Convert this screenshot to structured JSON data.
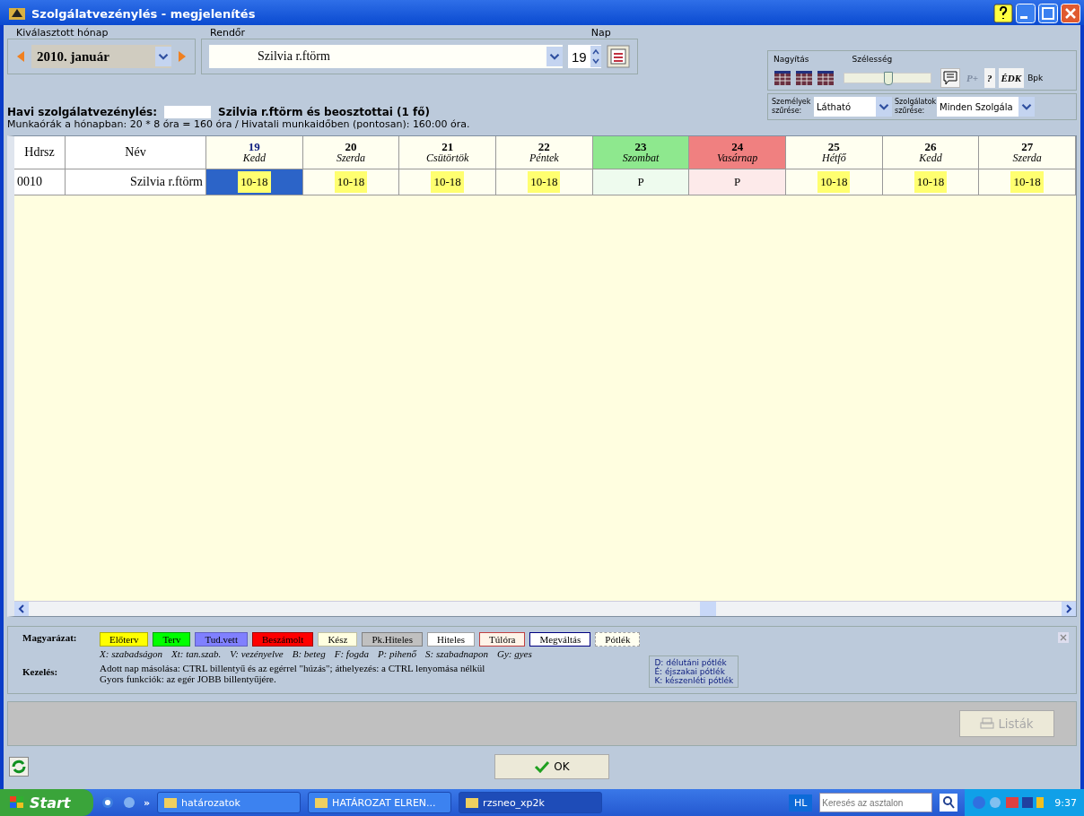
{
  "window": {
    "title": "Szolgálatvezénylés - megjelenítés"
  },
  "month": {
    "label": "Kiválasztott hónap",
    "value": "2010. január"
  },
  "officer": {
    "label": "Rendőr",
    "value": "Szilvia r.ftörm"
  },
  "day": {
    "label": "Nap",
    "value": "19"
  },
  "view": {
    "zoom_label": "Nagyítás",
    "width_label": "Szélesség",
    "width_slider": {
      "level": 0.5
    },
    "buttons": [
      {
        "label": "P+",
        "disabled": true
      },
      {
        "label": "?",
        "disabled": false
      },
      {
        "label": "ÉDK",
        "disabled": false
      }
    ],
    "region": "Bpk"
  },
  "filters": [
    {
      "label": "Személyek szűrése:",
      "value": "Látható"
    },
    {
      "label": "Szolgálatok szűrése:",
      "value": "Minden Szolgála"
    }
  ],
  "summary": {
    "title": "Havi szolgálatvezénylés:",
    "subject": "Szilvia r.ftörm és beosztottai (1 fő)",
    "hours": "Munkaórák a hónapban: 20 * 8 óra = 160 óra / Hivatali munkaidőben (pontosan): 160:00 óra."
  },
  "table": {
    "columns": [
      "Hdrsz",
      "Név"
    ],
    "days": [
      {
        "number": "19",
        "name": "Kedd",
        "kind": "weekday",
        "selected": true
      },
      {
        "number": "20",
        "name": "Szerda",
        "kind": "weekday",
        "selected": false
      },
      {
        "number": "21",
        "name": "Csütörtök",
        "kind": "weekday",
        "selected": false
      },
      {
        "number": "22",
        "name": "Péntek",
        "kind": "weekday",
        "selected": false
      },
      {
        "number": "23",
        "name": "Szombat",
        "kind": "saturday",
        "selected": false
      },
      {
        "number": "24",
        "name": "Vasárnap",
        "kind": "sunday",
        "selected": false
      },
      {
        "number": "25",
        "name": "Hétfő",
        "kind": "weekday",
        "selected": false
      },
      {
        "number": "26",
        "name": "Kedd",
        "kind": "weekday",
        "selected": false
      },
      {
        "number": "27",
        "name": "Szerda",
        "kind": "weekday",
        "selected": false
      }
    ],
    "rows": [
      {
        "id": "0010",
        "name": "Szilvia r.ftörm",
        "cells": [
          {
            "value": "10-18",
            "kind": "shift",
            "selected": true
          },
          {
            "value": "10-18",
            "kind": "shift",
            "selected": false
          },
          {
            "value": "10-18",
            "kind": "shift",
            "selected": false
          },
          {
            "value": "10-18",
            "kind": "shift",
            "selected": false
          },
          {
            "value": "P",
            "kind": "rest",
            "selected": false
          },
          {
            "value": "P",
            "kind": "rest",
            "selected": false
          },
          {
            "value": "10-18",
            "kind": "shift",
            "selected": false
          },
          {
            "value": "10-18",
            "kind": "shift",
            "selected": false
          },
          {
            "value": "10-18",
            "kind": "shift",
            "selected": false
          }
        ]
      }
    ]
  },
  "legend": {
    "label": "Magyarázat:",
    "items": [
      {
        "label": "Előterv",
        "color": "#ffff00"
      },
      {
        "label": "Terv",
        "color": "#00ff00"
      },
      {
        "label": "Tud.vett",
        "color": "#8080ff"
      },
      {
        "label": "Beszámolt",
        "color": "#ff0000"
      },
      {
        "label": "Kész",
        "color": "#ffffe0"
      },
      {
        "label": "Pk.Hiteles",
        "color": "#c0c0c0"
      },
      {
        "label": "Hiteles",
        "color": "#ffffff"
      },
      {
        "label": "Túlóra",
        "color": "#fff4e8"
      },
      {
        "label": "Megváltás",
        "color": "#ffffff"
      },
      {
        "label": "Pótlék",
        "color": "#fffff0"
      }
    ],
    "codes": [
      "X: szabadságon",
      "Xt: tan.szab.",
      "V: vezényelve",
      "B: beteg",
      "F: fogda",
      "P: pihenő",
      "S: szabadnapon",
      "Gy: gyes"
    ],
    "allowances": [
      "D: délutáni pótlék",
      "É: éjszakai pótlék",
      "K: készenléti pótlék"
    ]
  },
  "handling": {
    "label": "Kezelés:",
    "lines": [
      "Adott nap másolása: CTRL billentyű és az egérrel \"húzás\"; áthelyezés: a CTRL lenyomása nélkül",
      "Gyors funkciók: az egér JOBB billentyűjére."
    ]
  },
  "lists_button": {
    "label": "Listák",
    "disabled": true
  },
  "ok_button": {
    "label": "OK"
  },
  "taskbar": {
    "start": "Start",
    "chevron": "»",
    "tasks": [
      {
        "label": "határozatok",
        "selected": false
      },
      {
        "label": "HATÁROZAT ELREN...",
        "selected": false
      },
      {
        "label": "rzsneo_xp2k",
        "selected": true
      }
    ],
    "language": "HL",
    "search_placeholder": "Keresés az asztalon",
    "clock": "9:37"
  }
}
